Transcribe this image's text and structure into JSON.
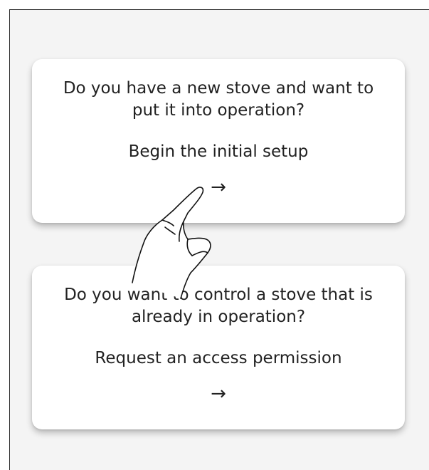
{
  "cards": [
    {
      "question": "Do you have a new stove and want to put it into operation?",
      "action": "Begin the initial setup",
      "arrow": "→"
    },
    {
      "question": "Do you want to control a stove that is already in operation?",
      "action": "Request an access permission",
      "arrow": "→"
    }
  ],
  "icons": {
    "arrow": "arrow-right-icon",
    "hand": "tap-hand-icon"
  },
  "colors": {
    "background": "#f4f4f4",
    "card": "#ffffff",
    "text": "#222222"
  }
}
